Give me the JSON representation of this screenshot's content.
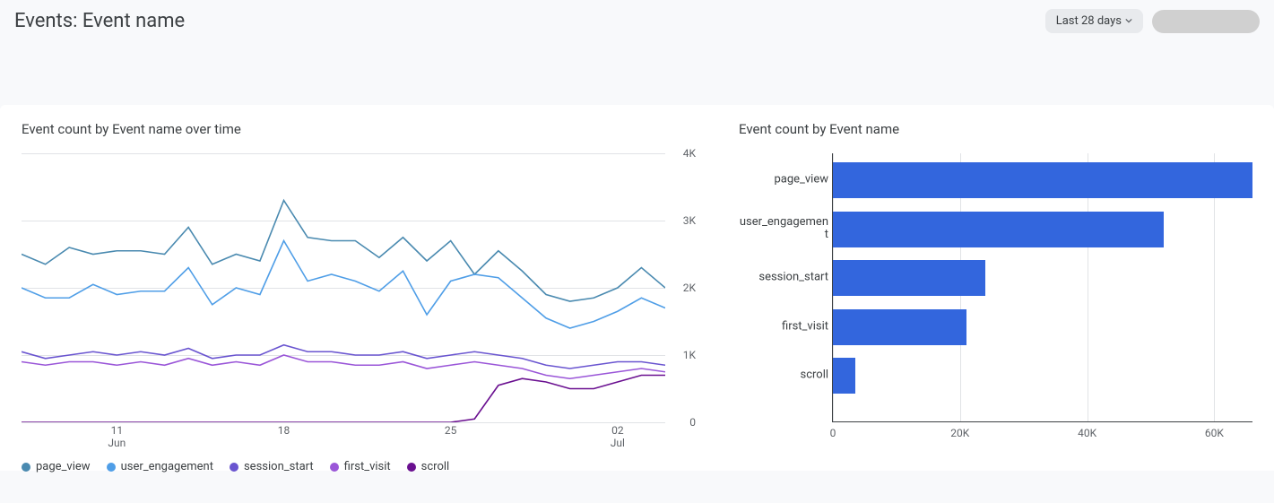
{
  "header": {
    "title": "Events: Event name",
    "range_chip": "Last 28 days"
  },
  "colors": {
    "page_view": "#4a8ab0",
    "user_engagement": "#4f9ee7",
    "session_start": "#6a55d0",
    "first_visit": "#9a56d8",
    "scroll": "#6a1090",
    "bar": "#3366dd"
  },
  "chart_data": [
    {
      "id": "line_chart",
      "title": "Event count by Event name over time",
      "type": "line",
      "ylim": [
        0,
        4000
      ],
      "yticks": [
        0,
        1000,
        2000,
        3000,
        4000
      ],
      "ytick_labels": [
        "0",
        "1K",
        "2K",
        "3K",
        "4K"
      ],
      "x": [
        "Jun 07",
        "Jun 08",
        "Jun 09",
        "Jun 10",
        "Jun 11",
        "Jun 12",
        "Jun 13",
        "Jun 14",
        "Jun 15",
        "Jun 16",
        "Jun 17",
        "Jun 18",
        "Jun 19",
        "Jun 20",
        "Jun 21",
        "Jun 22",
        "Jun 23",
        "Jun 24",
        "Jun 25",
        "Jun 26",
        "Jun 27",
        "Jun 28",
        "Jun 29",
        "Jun 30",
        "Jul 01",
        "Jul 02",
        "Jul 03",
        "Jul 04"
      ],
      "xticks": [
        {
          "i": 4,
          "label": "11",
          "sub": "Jun"
        },
        {
          "i": 11,
          "label": "18",
          "sub": ""
        },
        {
          "i": 18,
          "label": "25",
          "sub": ""
        },
        {
          "i": 25,
          "label": "02",
          "sub": "Jul"
        }
      ],
      "series": [
        {
          "name": "page_view",
          "values": [
            2500,
            2350,
            2600,
            2500,
            2550,
            2550,
            2500,
            2900,
            2350,
            2500,
            2400,
            3300,
            2750,
            2700,
            2700,
            2450,
            2750,
            2400,
            2700,
            2200,
            2550,
            2250,
            1900,
            1800,
            1850,
            2000,
            2300,
            2000
          ]
        },
        {
          "name": "user_engagement",
          "values": [
            2000,
            1850,
            1850,
            2050,
            1900,
            1950,
            1950,
            2300,
            1750,
            2000,
            1900,
            2700,
            2100,
            2200,
            2100,
            1950,
            2250,
            1600,
            2100,
            2200,
            2150,
            1850,
            1550,
            1400,
            1500,
            1650,
            1850,
            1700
          ]
        },
        {
          "name": "session_start",
          "values": [
            1050,
            950,
            1000,
            1050,
            1000,
            1050,
            1000,
            1100,
            950,
            1000,
            1000,
            1150,
            1050,
            1050,
            1000,
            1000,
            1050,
            950,
            1000,
            1050,
            1000,
            950,
            850,
            800,
            850,
            900,
            900,
            850
          ]
        },
        {
          "name": "first_visit",
          "values": [
            900,
            850,
            900,
            900,
            850,
            900,
            850,
            950,
            850,
            900,
            850,
            1000,
            900,
            900,
            850,
            850,
            900,
            800,
            850,
            900,
            850,
            800,
            700,
            650,
            700,
            750,
            800,
            750
          ]
        },
        {
          "name": "scroll",
          "values": [
            0,
            0,
            0,
            0,
            0,
            0,
            0,
            0,
            0,
            0,
            0,
            0,
            0,
            0,
            0,
            0,
            0,
            0,
            0,
            50,
            550,
            650,
            600,
            500,
            500,
            600,
            700,
            700
          ]
        }
      ],
      "legend": [
        "page_view",
        "user_engagement",
        "session_start",
        "first_visit",
        "scroll"
      ]
    },
    {
      "id": "bar_chart",
      "title": "Event count by Event name",
      "type": "bar",
      "orientation": "horizontal",
      "xlim": [
        0,
        66000
      ],
      "xticks": [
        0,
        20000,
        40000,
        60000
      ],
      "xtick_labels": [
        "0",
        "20K",
        "40K",
        "60K"
      ],
      "categories": [
        "page_view",
        "user_engagement",
        "session_start",
        "first_visit",
        "scroll"
      ],
      "category_labels": [
        "page_view",
        "user_engageme\nnt",
        "session_start",
        "first_visit",
        "scroll"
      ],
      "values": [
        66000,
        52000,
        24000,
        21000,
        3500
      ]
    }
  ]
}
